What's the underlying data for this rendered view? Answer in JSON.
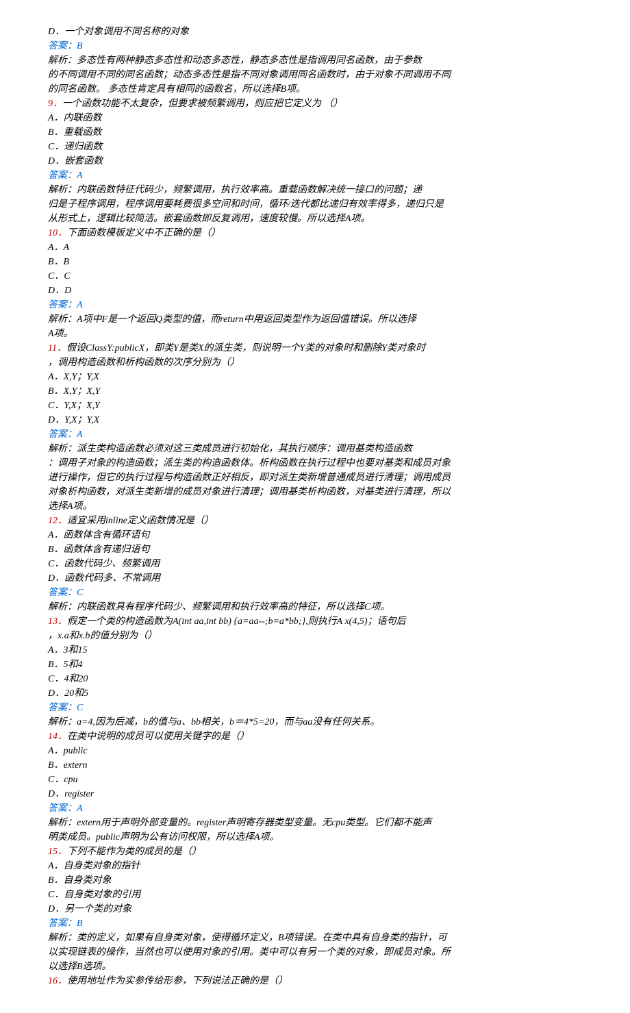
{
  "lines": [
    {
      "cls": "",
      "text": "D．一个对象调用不同名称的对象"
    },
    {
      "cls": "ans",
      "text": "答案：B"
    },
    {
      "cls": "",
      "text": "解析：多态性有两种静态多态性和动态多态性，静态多态性是指调用同名函数，由于参数"
    },
    {
      "cls": "",
      "text": "的不同调用不同的同名函数；动态多态性是指不同对象调用同名函数时，由于对象不同调用不同"
    },
    {
      "cls": "",
      "text": "的同名函数。 多态性肯定具有相同的函数名，所以选择B项。"
    },
    {
      "cls": "qnum",
      "text": "9．",
      "tail": "一个函数功能不太复杂，但要求被频繁调用，则应把它定义为 （）"
    },
    {
      "cls": "",
      "text": "A．内联函数"
    },
    {
      "cls": "",
      "text": "B．重载函数"
    },
    {
      "cls": "",
      "text": "C．递归函数"
    },
    {
      "cls": "",
      "text": "D．嵌套函数"
    },
    {
      "cls": "ans",
      "text": "答案：A"
    },
    {
      "cls": "",
      "text": "解析：内联函数特征代码少，频繁调用，执行效率高。重载函数解决统一接口的问题；递"
    },
    {
      "cls": "",
      "text": "归是子程序调用，程序调用要耗费很多空间和时间，循环/迭代都比递归有效率得多，递归只是"
    },
    {
      "cls": "",
      "text": "从形式上，逻辑比较简洁。嵌套函数即反复调用，速度较慢。所以选择A项。"
    },
    {
      "cls": "qnum",
      "text": "10．",
      "tail": "下面函数模板定义中不正确的是（）"
    },
    {
      "cls": "",
      "text": "A．A"
    },
    {
      "cls": "",
      "text": "B．B"
    },
    {
      "cls": "",
      "text": "C．C"
    },
    {
      "cls": "",
      "text": "D．D"
    },
    {
      "cls": "ans",
      "text": "答案：A"
    },
    {
      "cls": "",
      "text": "解析：A项中F是一个返回Q类型的值，而return中用返回类型作为返回值错误。所以选择"
    },
    {
      "cls": "",
      "text": "A项。"
    },
    {
      "cls": "qnum",
      "text": "11．",
      "tail": "假设ClassY:publicX，即类Y是类X的派生类，则说明一个Y类的对象时和删除Y类对象时"
    },
    {
      "cls": "",
      "text": "，调用构造函数和析构函数的次序分别为（）"
    },
    {
      "cls": "",
      "text": "A．X,Y；Y,X"
    },
    {
      "cls": "",
      "text": "B．X,Y；X,Y"
    },
    {
      "cls": "",
      "text": "C．Y,X；X,Y"
    },
    {
      "cls": "",
      "text": "D．Y,X；Y,X"
    },
    {
      "cls": "ans",
      "text": "答案：A"
    },
    {
      "cls": "",
      "text": "解析：派生类构造函数必须对这三类成员进行初始化，其执行顺序：调用基类构造函数"
    },
    {
      "cls": "",
      "text": "：调用子对象的构造函数；派生类的构造函数体。析构函数在执行过程中也要对基类和成员对象"
    },
    {
      "cls": "",
      "text": "进行操作，但它的执行过程与构造函数正好相反，即对派生类新增普通成员进行清理；调用成员"
    },
    {
      "cls": "",
      "text": "对象析构函数，对派生类新增的成员对象进行清理；调用基类析构函数，对基类进行清理，所以"
    },
    {
      "cls": "",
      "text": "选择A项。"
    },
    {
      "cls": "qnum",
      "text": "12．",
      "tail": "适宜采用inline定义函数情况是（）"
    },
    {
      "cls": "",
      "text": "A．函数体含有循环语句"
    },
    {
      "cls": "",
      "text": "B．函数体含有递归语句"
    },
    {
      "cls": "",
      "text": "C．函数代码少、频繁调用"
    },
    {
      "cls": "",
      "text": "D．函数代码多、不常调用"
    },
    {
      "cls": "ans",
      "text": "答案：C"
    },
    {
      "cls": "",
      "text": "解析：内联函数具有程序代码少、频繁调用和执行效率高的特征，所以选择C项。"
    },
    {
      "cls": "qnum",
      "text": "13．",
      "tail": "假定一个类的构造函数为A(int aa,int bb) {a=aa--;b=a*bb;},则执行A x(4,5)；语句后"
    },
    {
      "cls": "",
      "text": "，x.a和x.b的值分别为（）"
    },
    {
      "cls": "",
      "text": "A．3和15"
    },
    {
      "cls": "",
      "text": "B．5和4"
    },
    {
      "cls": "",
      "text": "C．4和20"
    },
    {
      "cls": "",
      "text": "D．20和5"
    },
    {
      "cls": "ans",
      "text": "答案：C"
    },
    {
      "cls": "",
      "text": "解析：a=4,因为后减，b的值与a、bb相关，b＝4*5=20，而与aa没有任何关系。"
    },
    {
      "cls": "qnum",
      "text": "14．",
      "tail": "在类中说明的成员可以使用关键字的是（）"
    },
    {
      "cls": "",
      "text": "A．public"
    },
    {
      "cls": "",
      "text": "B．extern"
    },
    {
      "cls": "",
      "text": "C．cpu"
    },
    {
      "cls": "",
      "text": "D．register"
    },
    {
      "cls": "ans",
      "text": "答案：A"
    },
    {
      "cls": "",
      "text": "解析：extern用于声明外部变量的。register声明寄存器类型变量。无cpu类型。它们都不能声"
    },
    {
      "cls": "",
      "text": "明类成员。public声明为公有访问权限，所以选择A项。"
    },
    {
      "cls": "qnum",
      "text": "15．",
      "tail": "下列不能作为类的成员的是（）"
    },
    {
      "cls": "",
      "text": "A．自身类对象的指针"
    },
    {
      "cls": "",
      "text": "B．自身类对象"
    },
    {
      "cls": "",
      "text": "C．自身类对象的引用"
    },
    {
      "cls": "",
      "text": "D．另一个类的对象"
    },
    {
      "cls": "ans",
      "text": "答案：B"
    },
    {
      "cls": "",
      "text": "解析：类的定义，如果有自身类对象，使得循环定义，B项错误。在类中具有自身类的指针，可"
    },
    {
      "cls": "",
      "text": "以实现链表的操作，当然也可以使用对象的引用。类中可以有另一个类的对象，即成员对象。所"
    },
    {
      "cls": "",
      "text": "以选择B选项。"
    },
    {
      "cls": "qnum",
      "text": "16．",
      "tail": "使用地址作为实参传给形参，下列说法正确的是（）"
    }
  ]
}
